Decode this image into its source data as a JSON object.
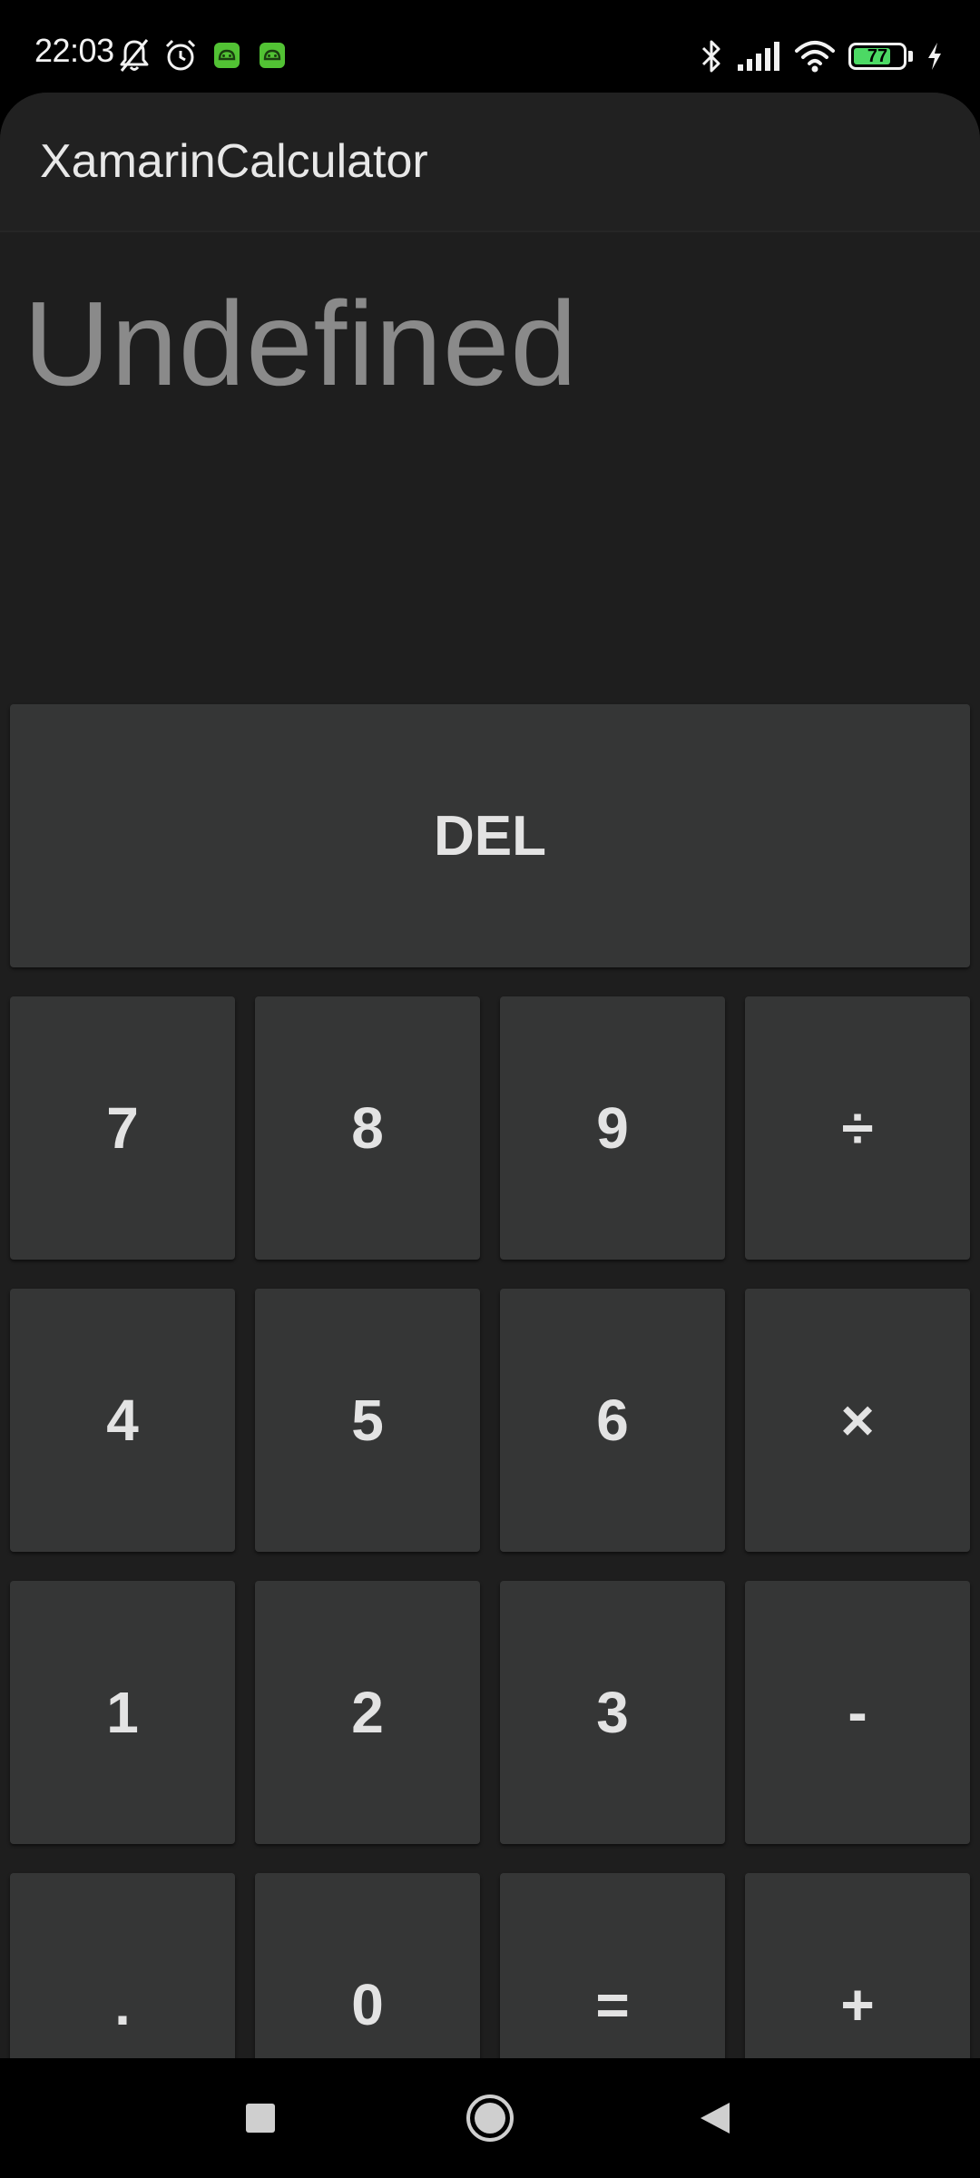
{
  "status_bar": {
    "time": "22:03",
    "battery_level": "77",
    "battery_fraction": 0.77,
    "icons_left": [
      "mute-bell-icon",
      "alarm-icon",
      "android-notification-icon",
      "android-notification-icon"
    ],
    "icons_right": [
      "bluetooth-icon",
      "cellular-signal-icon",
      "wifi-icon",
      "battery-icon",
      "charging-bolt-icon"
    ]
  },
  "app": {
    "title": "XamarinCalculator"
  },
  "display": {
    "value": "Undefined"
  },
  "keypad": {
    "del_label": "DEL",
    "rows": [
      [
        "7",
        "8",
        "9",
        "÷"
      ],
      [
        "4",
        "5",
        "6",
        "×"
      ],
      [
        "1",
        "2",
        "3",
        "-"
      ],
      [
        ".",
        "0",
        "=",
        "+"
      ]
    ]
  },
  "nav_bar": {
    "icons": [
      "recents-square-icon",
      "home-circle-icon",
      "back-triangle-icon"
    ]
  },
  "colors": {
    "background": "#1e1e1e",
    "toolbar": "#212121",
    "key": "#353636",
    "key_text": "#e3e3e3",
    "display_text": "#8a8a8a",
    "battery_fill": "#4cd964"
  }
}
